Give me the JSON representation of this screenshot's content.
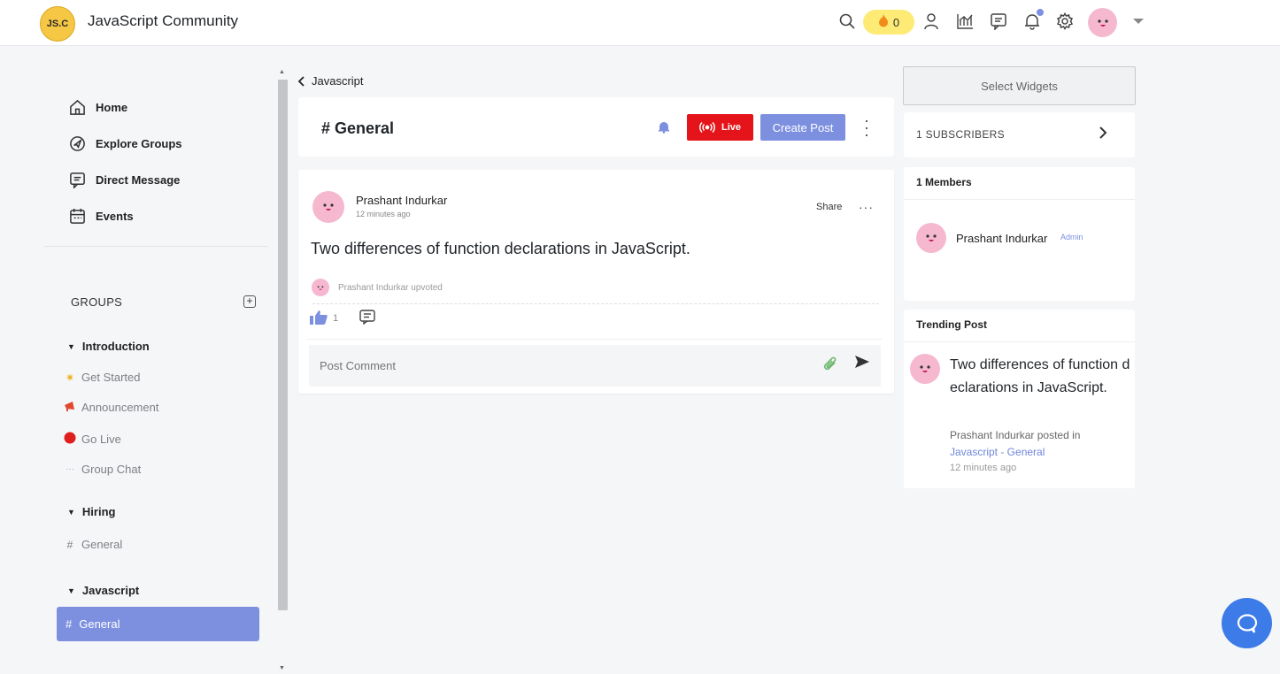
{
  "header": {
    "logo_text": "JS.C",
    "app_title": "JavaScript Community",
    "streak_count": "0",
    "icons": [
      "search-icon",
      "fire-icon",
      "user-icon",
      "chart-icon",
      "chat-icon",
      "bell-icon",
      "gear-icon",
      "chevron-down-icon"
    ]
  },
  "sidebar": {
    "nav": [
      {
        "label": "Home",
        "icon": "home-icon"
      },
      {
        "label": "Explore Groups",
        "icon": "compass-icon"
      },
      {
        "label": "Direct Message",
        "icon": "message-icon"
      },
      {
        "label": "Events",
        "icon": "calendar-icon"
      }
    ],
    "groups_label": "GROUPS",
    "groups": [
      {
        "name": "Introduction",
        "channels": [
          {
            "label": "Get Started",
            "icon": "sparkle-icon"
          },
          {
            "label": "Announcement",
            "icon": "megaphone-icon"
          },
          {
            "label": "Go Live",
            "icon": "live-dot-icon"
          },
          {
            "label": "Group Chat",
            "icon": "chat-bubble-icon"
          }
        ]
      },
      {
        "name": "Hiring",
        "channels": [
          {
            "label": "General",
            "icon": "hash-icon"
          }
        ]
      },
      {
        "name": "Javascript",
        "channels": [
          {
            "label": "General",
            "icon": "hash-icon",
            "active": true
          }
        ]
      }
    ]
  },
  "main": {
    "breadcrumb": "Javascript",
    "channel_title": "# General",
    "live_label": "Live",
    "create_post_label": "Create Post",
    "post": {
      "author": "Prashant Indurkar",
      "time": "12 minutes ago",
      "share_label": "Share",
      "title": "Two differences of function declarations in JavaScript.",
      "upvote_text": "Prashant Indurkar upvoted",
      "like_count": "1",
      "comment_placeholder": "Post Comment"
    }
  },
  "right": {
    "widgets_label": "Select Widgets",
    "subscribers_label": "1 SUBSCRIBERS",
    "members_title": "1 Members",
    "member": {
      "name": "Prashant Indurkar",
      "role": "Admin"
    },
    "trending_title": "Trending Post",
    "trending_post": {
      "title": "Two differences of function declarations in JavaScript.",
      "by": "Prashant Indurkar posted in",
      "link": "Javascript - General",
      "time": "12 minutes ago"
    }
  },
  "colors": {
    "accent": "#7d90e0",
    "live": "#e5141a",
    "logo": "#f6c744",
    "fab": "#3c7be8"
  }
}
